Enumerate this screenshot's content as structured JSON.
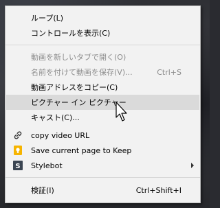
{
  "menu": {
    "items": [
      {
        "label": "ループ(L)",
        "shortcut": "",
        "disabled": false
      },
      {
        "label": "コントロールを表示(C)",
        "shortcut": "",
        "disabled": false
      },
      {
        "label": "動画を新しいタブで開く(O)",
        "shortcut": "",
        "disabled": true
      },
      {
        "label": "名前を付けて動画を保存(V)...",
        "shortcut": "Ctrl+S",
        "disabled": true
      },
      {
        "label": "動画アドレスをコピー(C)",
        "shortcut": "",
        "disabled": false
      },
      {
        "label": "ピクチャー イン ピクチャー",
        "shortcut": "",
        "disabled": false,
        "highlighted": true
      },
      {
        "label": "キャスト(C)...",
        "shortcut": "",
        "disabled": false
      },
      {
        "label": "copy video URL",
        "shortcut": "",
        "disabled": false,
        "icon": "link-icon"
      },
      {
        "label": "Save current page to Keep",
        "shortcut": "",
        "disabled": false,
        "icon": "keep-icon"
      },
      {
        "label": "Stylebot",
        "shortcut": "",
        "disabled": false,
        "icon": "stylebot-icon",
        "submenu": true
      },
      {
        "label": "検証(I)",
        "shortcut": "Ctrl+Shift+I",
        "disabled": false
      }
    ]
  },
  "colors": {
    "menu_background": "#f2f2f2",
    "highlight": "#dadada",
    "disabled_text": "#8c8c8c",
    "keep_yellow": "#f6b400",
    "stylebot_dark": "#3b4552"
  }
}
